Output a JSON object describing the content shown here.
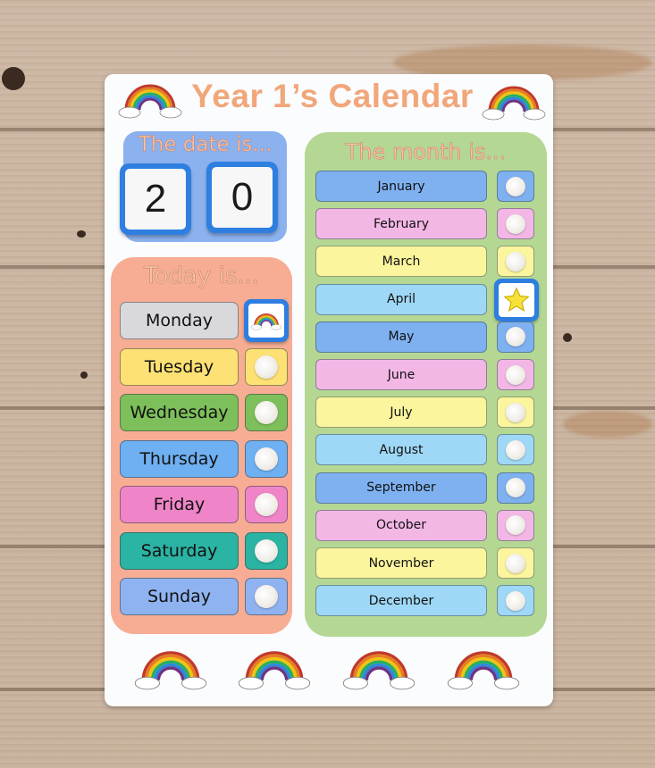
{
  "scene": "Classroom calendar board on wooden background",
  "title": "Year 1’s Calendar",
  "date_panel": {
    "heading": "The date is...",
    "digits": [
      "2",
      "0"
    ],
    "color": "#8bb1ef"
  },
  "today_panel": {
    "heading": "Today is...",
    "color": "#f7ad94",
    "selected_marker": "rainbow-icon",
    "days": [
      {
        "label": "Monday",
        "color": "#d9d9dc",
        "slot": "rainbow-marker",
        "selected": true
      },
      {
        "label": "Tuesday",
        "color": "#fde174",
        "slot": "velcro-dot",
        "selected": false
      },
      {
        "label": "Wednesday",
        "color": "#7dbf5a",
        "slot": "velcro-dot",
        "selected": false
      },
      {
        "label": "Thursday",
        "color": "#6fb0f2",
        "slot": "velcro-dot",
        "selected": false
      },
      {
        "label": "Friday",
        "color": "#ef85c8",
        "slot": "velcro-dot",
        "selected": false
      },
      {
        "label": "Saturday",
        "color": "#2bb3a3",
        "slot": "velcro-dot",
        "selected": false
      },
      {
        "label": "Sunday",
        "color": "#8fb3f0",
        "slot": "velcro-dot",
        "selected": false
      }
    ]
  },
  "month_panel": {
    "heading": "The month is...",
    "color": "#b4d894",
    "selected_marker": "star-icon",
    "months": [
      {
        "label": "January",
        "color": "#7fb1f0",
        "slot": "velcro-dot"
      },
      {
        "label": "February",
        "color": "#f3b7e6",
        "slot": "velcro-dot"
      },
      {
        "label": "March",
        "color": "#fbf59e",
        "slot": "velcro-dot"
      },
      {
        "label": "April",
        "color": "#9fd8f6",
        "slot": "star-marker",
        "selected": true
      },
      {
        "label": "May",
        "color": "#7fb1f0",
        "slot": "velcro-dot"
      },
      {
        "label": "June",
        "color": "#f3b7e6",
        "slot": "velcro-dot"
      },
      {
        "label": "July",
        "color": "#fbf59e",
        "slot": "velcro-dot"
      },
      {
        "label": "August",
        "color": "#9fd8f6",
        "slot": "velcro-dot"
      },
      {
        "label": "September",
        "color": "#7fb1f0",
        "slot": "velcro-dot"
      },
      {
        "label": "October",
        "color": "#f3b7e6",
        "slot": "velcro-dot"
      },
      {
        "label": "November",
        "color": "#fbf59e",
        "slot": "velcro-dot"
      },
      {
        "label": "December",
        "color": "#9fd8f6",
        "slot": "velcro-dot"
      }
    ]
  },
  "decorations": {
    "header_icons": [
      "rainbow-icon",
      "rainbow-icon"
    ],
    "footer_icons": [
      "rainbow-icon",
      "rainbow-icon",
      "rainbow-icon",
      "rainbow-icon"
    ]
  },
  "colors": {
    "title": "#f1a77a",
    "tile_blue": "#2d7ee0",
    "board": "#fbfcfd"
  }
}
